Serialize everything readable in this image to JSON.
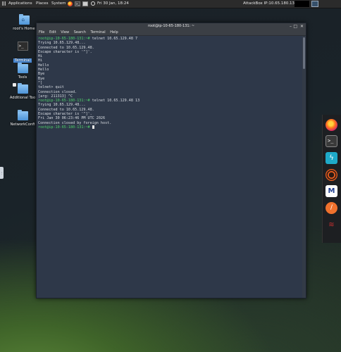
{
  "topbar": {
    "applications": "Applications",
    "places": "Places",
    "system": "System",
    "datetime": "Fri 30 Jan, 18:24",
    "machine_ip": "AttackBox IP:10.65.180.131"
  },
  "desktop": {
    "icons": [
      {
        "label": "root's Home"
      },
      {
        "label": "Terminal"
      },
      {
        "label": "Tools"
      },
      {
        "label": "Additional Too"
      },
      {
        "label": "NetworkConfi"
      }
    ]
  },
  "window": {
    "title": "root@ip-10-65-180-131: ~",
    "menu": [
      "File",
      "Edit",
      "View",
      "Search",
      "Terminal",
      "Help"
    ],
    "lines": [
      {
        "prompt": "root@ip-10-65-180-131:~#",
        "text": " telnet 10.65.129.48 7"
      },
      {
        "prompt": "",
        "text": "Trying 10.65.129.48..."
      },
      {
        "prompt": "",
        "text": "Connected to 10.65.129.48."
      },
      {
        "prompt": "",
        "text": "Escape character is '^]'."
      },
      {
        "prompt": "",
        "text": "Hi"
      },
      {
        "prompt": "",
        "text": "Hi"
      },
      {
        "prompt": "",
        "text": "Hello"
      },
      {
        "prompt": "",
        "text": "Hello"
      },
      {
        "prompt": "",
        "text": "Bye"
      },
      {
        "prompt": "",
        "text": "Bye"
      },
      {
        "prompt": "",
        "text": "^]"
      },
      {
        "prompt": "",
        "text": "telnet> quit"
      },
      {
        "prompt": "",
        "text": "Connection closed."
      },
      {
        "prompt": "",
        "text": "[arg: 211313] ^C"
      },
      {
        "prompt": "root@ip-10-65-180-131:~#",
        "text": " telnet 10.65.129.48 13"
      },
      {
        "prompt": "",
        "text": "Trying 10.65.129.48..."
      },
      {
        "prompt": "",
        "text": "Connected to 10.65.129.48."
      },
      {
        "prompt": "",
        "text": "Escape character is '^]'."
      },
      {
        "prompt": "",
        "text": "Fri Jan 30 06:23:46 PM UTC 2026"
      },
      {
        "prompt": "",
        "text": "Connection closed by foreign host."
      },
      {
        "prompt": "root@ip-10-65-180-131:~#",
        "text": " "
      }
    ]
  },
  "dock": {
    "apps": [
      "firefox-icon",
      "terminal-icon",
      "tryhackme-icon",
      "burp-icon",
      "metasploit-icon",
      "feather-icon",
      "tool-icon"
    ]
  }
}
